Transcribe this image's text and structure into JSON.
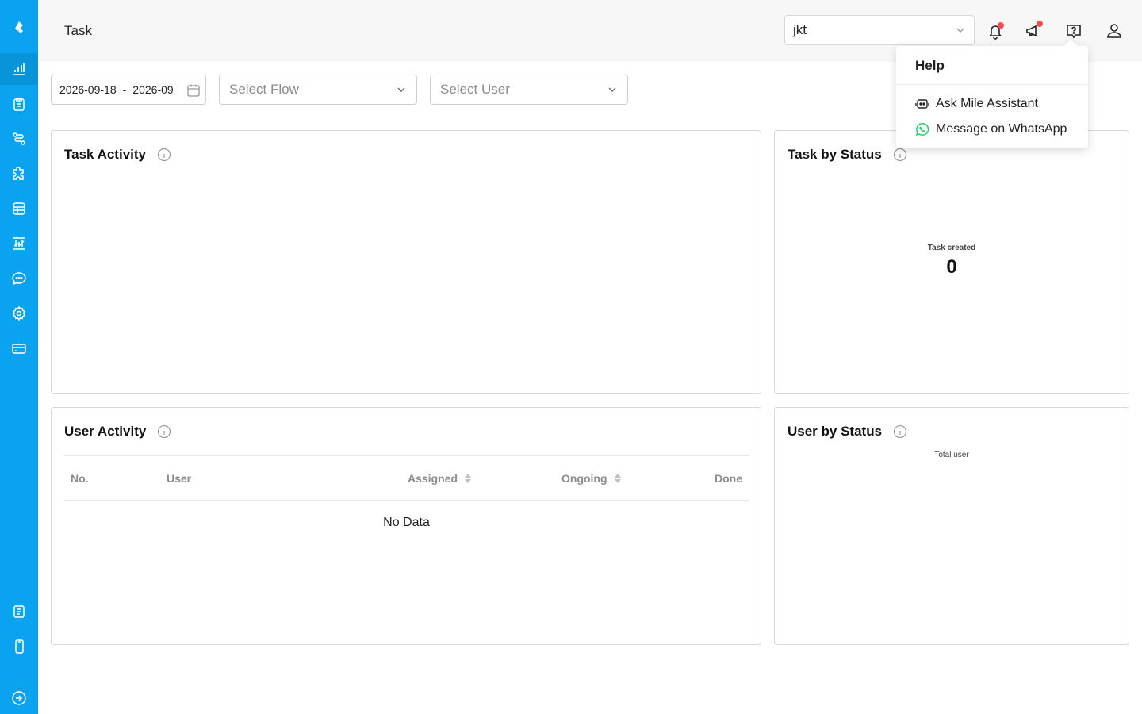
{
  "header": {
    "title": "Task",
    "workspace_value": "jkt"
  },
  "sidebar": {
    "items": [
      {
        "icon": "logo-icon"
      },
      {
        "icon": "bar-chart-icon",
        "active": true
      },
      {
        "icon": "clipboard-icon"
      },
      {
        "icon": "flow-icon"
      },
      {
        "icon": "puzzle-icon"
      },
      {
        "icon": "database-icon"
      },
      {
        "icon": "report-icon"
      },
      {
        "icon": "chat-icon"
      },
      {
        "icon": "gear-icon"
      },
      {
        "icon": "card-icon"
      },
      {
        "icon": "document-icon"
      },
      {
        "icon": "mobile-icon"
      },
      {
        "icon": "logout-icon"
      }
    ]
  },
  "filters": {
    "date_start": "2026-09-18",
    "date_sep": "-",
    "date_end": "2026-09",
    "flow_placeholder": "Select Flow",
    "user_placeholder": "Select User"
  },
  "task_activity": {
    "title": "Task Activity"
  },
  "task_by_status": {
    "title": "Task by Status",
    "label": "Task created",
    "value": "0"
  },
  "user_activity": {
    "title": "User Activity",
    "columns": [
      "No.",
      "User",
      "Assigned",
      "Ongoing",
      "Done"
    ],
    "empty_text": "No Data"
  },
  "user_by_status": {
    "title": "User by Status",
    "label": "Total user"
  },
  "help_popover": {
    "title": "Help",
    "items": [
      {
        "label": "Ask Mile Assistant",
        "icon": "robot-icon"
      },
      {
        "label": "Message on WhatsApp",
        "icon": "whatsapp-icon",
        "color": "#25d366"
      }
    ]
  },
  "colors": {
    "sidebar": "#0aa3ef",
    "notification_dot": "#ff4d4f"
  }
}
